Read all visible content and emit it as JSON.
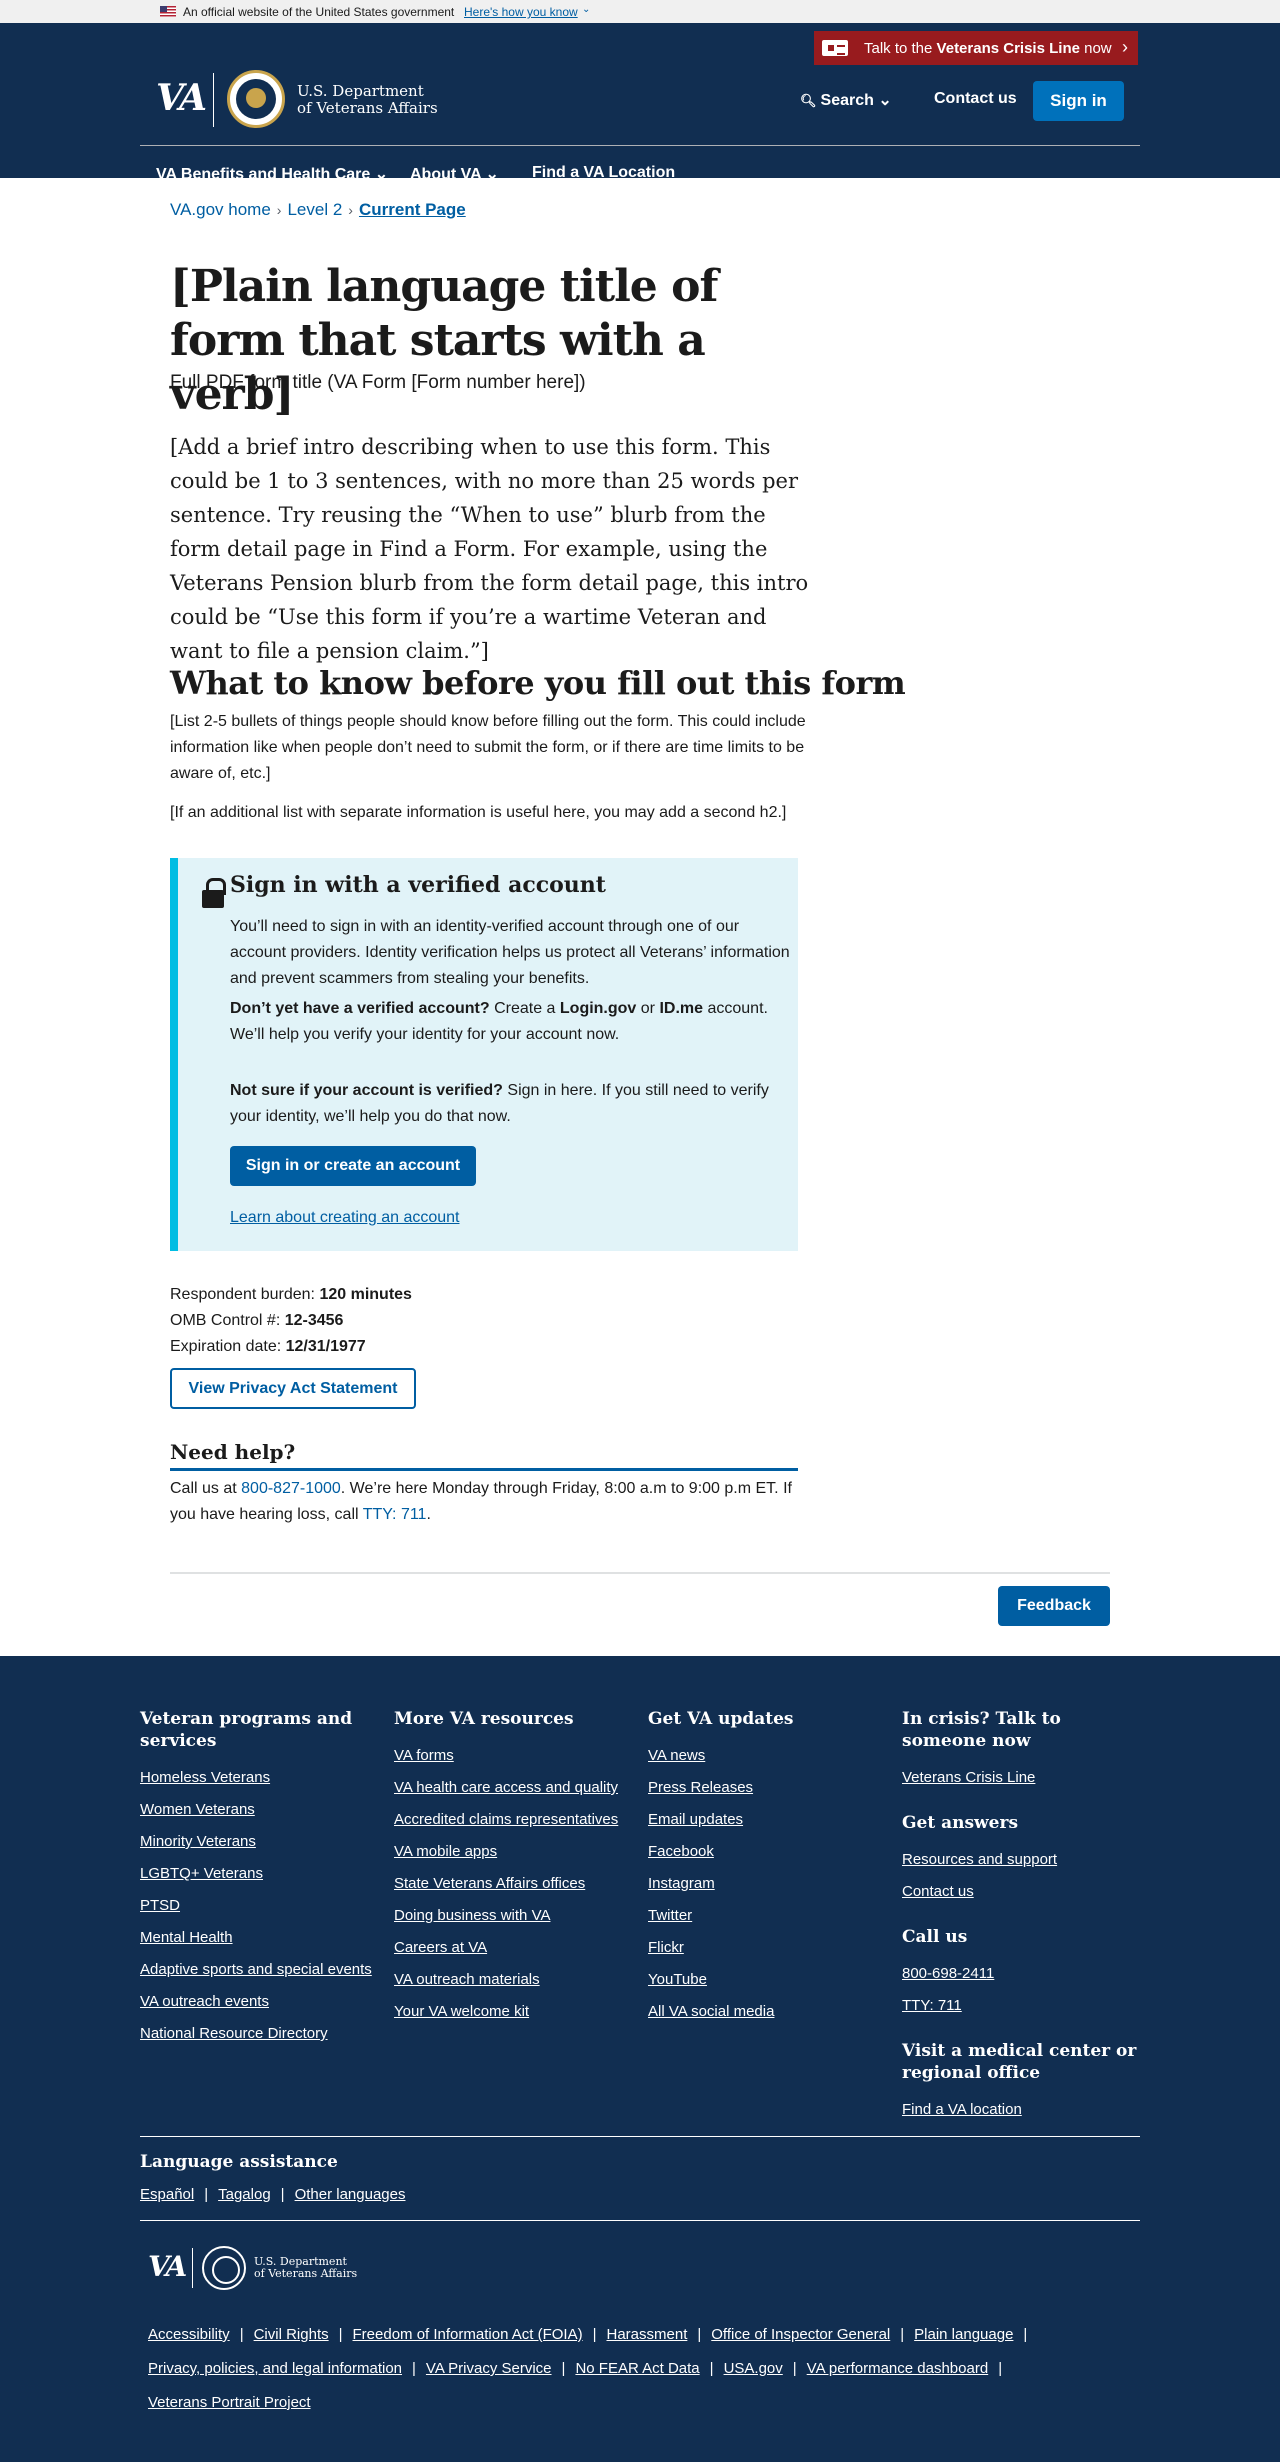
{
  "gov_banner": {
    "text": "An official website of the United States government",
    "link": "Here's how you know"
  },
  "crisis": {
    "prefix": "Talk to the ",
    "bold": "Veterans Crisis Line",
    "suffix": " now"
  },
  "header": {
    "logo": "VA",
    "dept_line1": "U.S. Department",
    "dept_line2": "of Veterans Affairs",
    "search": "Search",
    "contact": "Contact us",
    "signin": "Sign in",
    "nav": [
      "VA Benefits and Health Care",
      "About VA",
      "Find a VA Location"
    ]
  },
  "breadcrumb": [
    "VA.gov home",
    "Level 2",
    "Current Page"
  ],
  "page": {
    "title": "[Plain language title of form that starts with a verb]",
    "pdf_title": "Full PDF form title (VA Form [Form number here])",
    "intro": "[Add a brief intro describing when to use this form. This could be 1 to 3 sentences, with no more than 25 words per sentence. Try reusing the “When to use” blurb from the form detail page in Find a Form. For example, using the Veterans Pension blurb from the form detail page, this intro could be “Use this form if you’re a wartime Veteran and want to file a pension claim.”]",
    "know_heading": "What to know before you fill out this form",
    "know_p1": "[List 2-5 bullets of things people should know before filling out the form. This could include information like when people don’t need to submit the form, or if there are time limits to be aware of, etc.]",
    "know_p2": "[If an additional list with separate information is useful here, you may add a second h2.]"
  },
  "alert": {
    "heading": "Sign in with a verified account",
    "p1": "You’ll need to sign in with an identity-verified account through one of our account providers. Identity verification helps us protect all Veterans’ information and prevent scammers from stealing your benefits.",
    "p2_bold": "Don’t yet have a verified account?",
    "p2_a": " Create a ",
    "p2_login": "Login.gov",
    "p2_or": " or ",
    "p2_idme": "ID.me",
    "p2_b": " account. We’ll help you verify your identity for your account now.",
    "p3_bold": "Not sure if your account is verified?",
    "p3": " Sign in here. If you still need to verify your identity, we’ll help you do that now.",
    "button": "Sign in or create an account",
    "link": "Learn about creating an account"
  },
  "meta": {
    "burden_label": "Respondent burden: ",
    "burden": "120 minutes",
    "omb_label": "OMB Control #: ",
    "omb": "12-3456",
    "exp_label": "Expiration date: ",
    "exp": "12/31/1977"
  },
  "privacy_button": "View Privacy Act Statement",
  "help": {
    "heading": "Need help?",
    "a": "Call us at ",
    "phone": "800-827-1000",
    "b": ". We’re here Monday through Friday, 8:00 a.m to 9:00 p.m ET. If you have hearing loss, call ",
    "tty": "TTY: 711",
    "c": "."
  },
  "feedback": "Feedback",
  "footer": {
    "col1": {
      "heading": "Veteran programs and services",
      "links": [
        "Homeless Veterans",
        "Women Veterans",
        "Minority Veterans",
        "LGBTQ+ Veterans",
        "PTSD",
        "Mental Health",
        "Adaptive sports and special events",
        "VA outreach events",
        "National Resource Directory"
      ]
    },
    "col2": {
      "heading": "More VA resources",
      "links": [
        "VA forms",
        "VA health care access and quality",
        "Accredited claims representatives",
        "VA mobile apps",
        "State Veterans Affairs offices",
        "Doing business with VA",
        "Careers at VA",
        "VA outreach materials",
        "Your VA welcome kit"
      ]
    },
    "col3": {
      "heading": "Get VA updates",
      "links": [
        "VA news",
        "Press Releases",
        "Email updates",
        "Facebook",
        "Instagram",
        "Twitter",
        "Flickr",
        "YouTube",
        "All VA social media"
      ]
    },
    "col4": {
      "crisis_heading": "In crisis? Talk to someone now",
      "crisis_link": "Veterans Crisis Line",
      "answers_heading": "Get answers",
      "answers_links": [
        "Resources and support",
        "Contact us"
      ],
      "call_heading": "Call us",
      "call_links": [
        "800-698-2411",
        "TTY: 711"
      ],
      "visit_heading": "Visit a medical center or regional office",
      "visit_link": "Find a VA location"
    },
    "lang_heading": "Language assistance",
    "lang_links": [
      "Español",
      "Tagalog",
      "Other languages"
    ],
    "logo": "VA",
    "dept_line1": "U.S. Department",
    "dept_line2": "of Veterans Affairs",
    "legal_row1": [
      "Accessibility",
      "Civil Rights",
      "Freedom of Information Act (FOIA)",
      "Harassment",
      "Office of Inspector General",
      "Plain language"
    ],
    "legal_row2": [
      "Privacy, policies, and legal information",
      "VA Privacy Service",
      "No FEAR Act Data",
      "USA.gov",
      "VA performance dashboard"
    ],
    "legal_row3": [
      "Veterans Portrait Project"
    ]
  }
}
